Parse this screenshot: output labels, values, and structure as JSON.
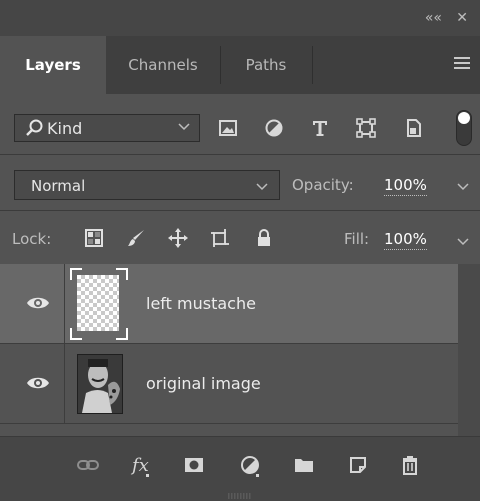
{
  "window": {
    "collapse_glyph": "««",
    "close_glyph": "✕"
  },
  "tabs": [
    {
      "label": "Layers",
      "active": true
    },
    {
      "label": "Channels",
      "active": false
    },
    {
      "label": "Paths",
      "active": false
    }
  ],
  "filter": {
    "kind_label": "Kind",
    "icons": [
      "pixel-layer-filter-icon",
      "adjustment-layer-filter-icon",
      "type-layer-filter-icon",
      "shape-layer-filter-icon",
      "smart-object-filter-icon"
    ],
    "filtering_on": true
  },
  "blend": {
    "mode": "Normal",
    "opacity_label": "Opacity:",
    "opacity_value": "100%"
  },
  "lock": {
    "label": "Lock:",
    "fill_label": "Fill:",
    "fill_value": "100%"
  },
  "layers": [
    {
      "name": "left mustache",
      "visible": true,
      "selected": true,
      "thumbnail": "transparent-checkerboard"
    },
    {
      "name": "original image",
      "visible": true,
      "selected": false,
      "thumbnail": "photo"
    }
  ],
  "bottom_icons": [
    "link-layers-icon",
    "fx-icon",
    "layer-mask-icon",
    "adjustment-layer-icon",
    "group-folder-icon",
    "new-layer-icon",
    "trash-icon"
  ],
  "colors": {
    "panel_bg": "#535353",
    "tab_bar_bg": "#3f3f3f",
    "selected_layer_bg": "#686868",
    "text_active": "#ffffff"
  }
}
